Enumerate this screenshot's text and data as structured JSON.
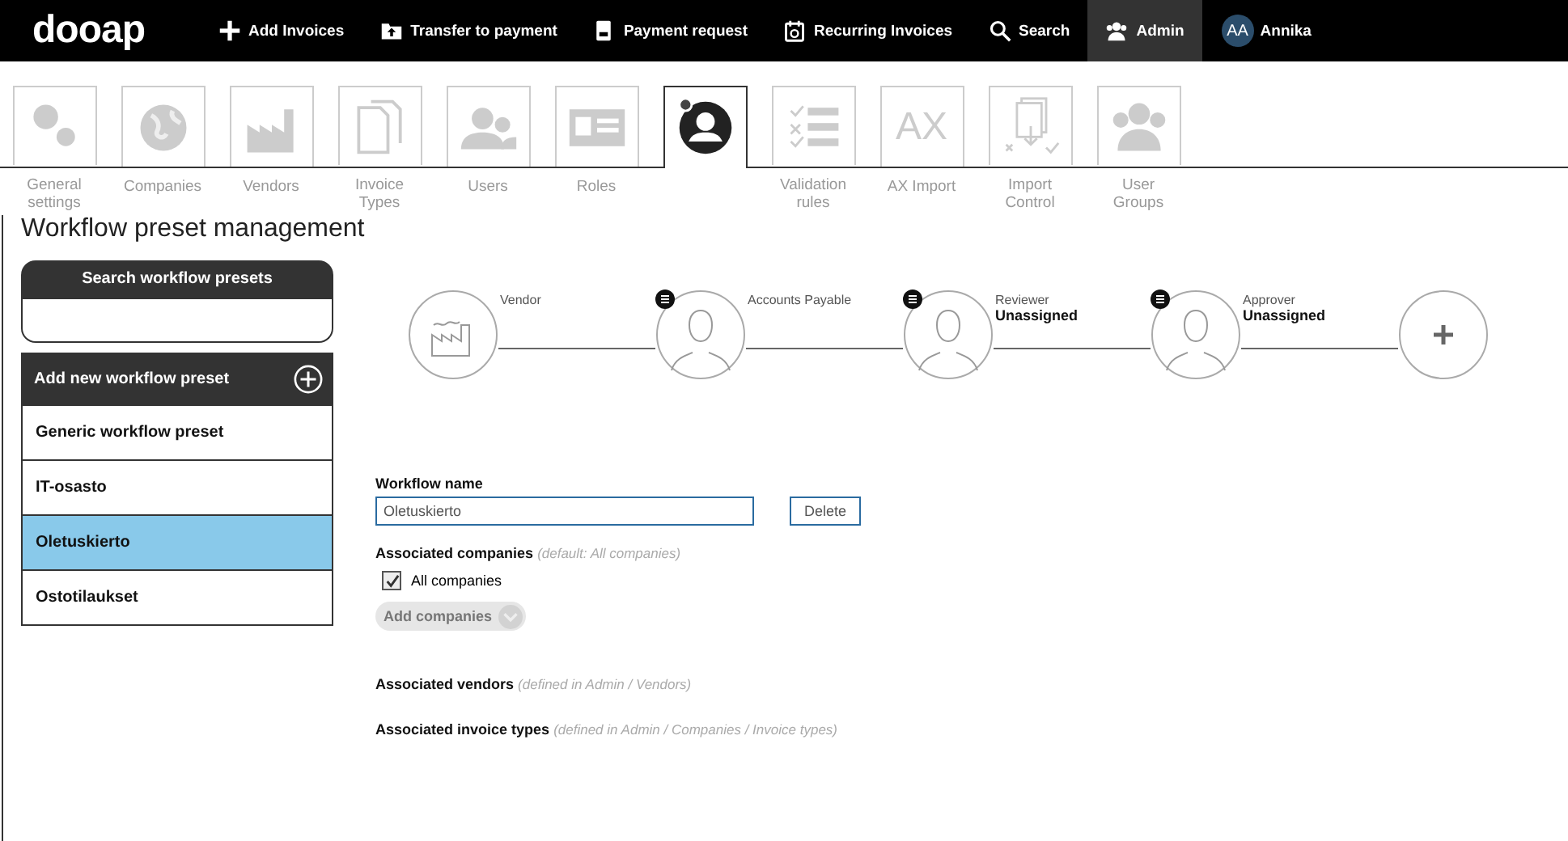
{
  "brand": "dooap",
  "nav": [
    {
      "label": "Add Invoices",
      "selected": false
    },
    {
      "label": "Transfer to payment",
      "selected": false
    },
    {
      "label": "Payment request",
      "selected": false
    },
    {
      "label": "Recurring Invoices",
      "selected": false
    },
    {
      "label": "Search",
      "selected": false
    },
    {
      "label": "Admin",
      "selected": true
    }
  ],
  "user": {
    "initials": "AA",
    "name": "Annika"
  },
  "tabs": [
    {
      "label": "General settings",
      "selected": false
    },
    {
      "label": "Companies",
      "selected": false
    },
    {
      "label": "Vendors",
      "selected": false
    },
    {
      "label": "Invoice Types",
      "selected": false
    },
    {
      "label": "Users",
      "selected": false
    },
    {
      "label": "Roles",
      "selected": false
    },
    {
      "selected": true
    },
    {
      "label": "Validation rules",
      "selected": false
    },
    {
      "label": "AX Import",
      "selected": false,
      "glyph": "AX"
    },
    {
      "label": "Import Control",
      "selected": false
    },
    {
      "label": "User Groups",
      "selected": false
    }
  ],
  "page_title": "Workflow preset management",
  "sidebar": {
    "search_title": "Search workflow presets",
    "add_label": "Add new workflow preset",
    "items": [
      {
        "label": "Generic workflow preset",
        "selected": false
      },
      {
        "label": "IT-osasto",
        "selected": false
      },
      {
        "label": "Oletuskierto",
        "selected": true
      },
      {
        "label": "Ostotilaukset",
        "selected": false
      }
    ]
  },
  "workflow": [
    {
      "kind": "vendor",
      "role": "Vendor"
    },
    {
      "kind": "person",
      "role": "Accounts Payable"
    },
    {
      "kind": "person",
      "role": "Reviewer",
      "assignee": "Unassigned"
    },
    {
      "kind": "person",
      "role": "Approver",
      "assignee": "Unassigned"
    },
    {
      "kind": "add"
    }
  ],
  "form": {
    "name_label": "Workflow name",
    "name_value": "Oletuskierto",
    "delete_label": "Delete",
    "companies_label": "Associated companies",
    "companies_hint": "(default: All companies)",
    "all_companies": {
      "label": "All companies",
      "checked": true
    },
    "add_companies": "Add companies",
    "vendors_label": "Associated vendors",
    "vendors_hint": "(defined in Admin / Vendors)",
    "types_label": "Associated invoice types",
    "types_hint": "(defined in Admin / Companies / Invoice types)"
  }
}
